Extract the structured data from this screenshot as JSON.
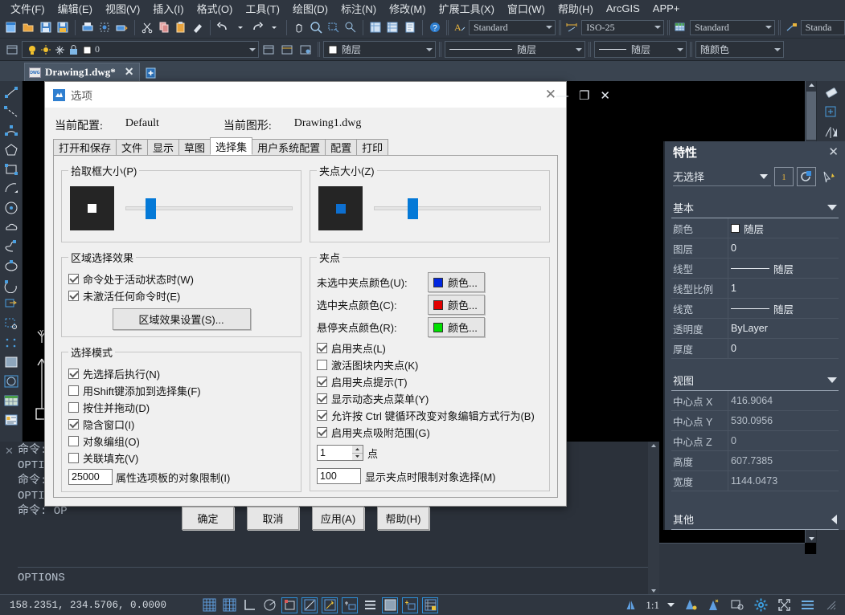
{
  "menubar": {
    "items": [
      "文件(F)",
      "编辑(E)",
      "视图(V)",
      "插入(I)",
      "格式(O)",
      "工具(T)",
      "绘图(D)",
      "标注(N)",
      "修改(M)",
      "扩展工具(X)",
      "窗口(W)",
      "帮助(H)",
      "ArcGIS",
      "APP+"
    ]
  },
  "toolbar1": {
    "style_combo": "Standard",
    "dim_combo": "ISO-25",
    "table_combo": "Standard",
    "multileader_combo": "Standa"
  },
  "toolbar2": {
    "layer_combo": "0",
    "color_combo": "随层",
    "linetype_combo": "随层",
    "lineweight_combo": "随层",
    "plotstyle_combo": "随颜色"
  },
  "drawing_tab": {
    "name": "Drawing1.dwg*",
    "close": "✕",
    "new_tab": "+"
  },
  "properties": {
    "title": "特性",
    "close": "✕",
    "selection": "无选择",
    "groups": [
      {
        "name": "基本",
        "rows": [
          {
            "key": "颜色",
            "value": "随层",
            "kind": "color"
          },
          {
            "key": "图层",
            "value": "0",
            "kind": "text"
          },
          {
            "key": "线型",
            "value": "随层",
            "kind": "line"
          },
          {
            "key": "线型比例",
            "value": "1",
            "kind": "text"
          },
          {
            "key": "线宽",
            "value": "随层",
            "kind": "line"
          },
          {
            "key": "透明度",
            "value": "ByLayer",
            "kind": "text"
          },
          {
            "key": "厚度",
            "value": "0",
            "kind": "text"
          }
        ]
      },
      {
        "name": "视图",
        "rows": [
          {
            "key": "中心点 X",
            "value": "416.9064",
            "kind": "dim"
          },
          {
            "key": "中心点 Y",
            "value": "530.0956",
            "kind": "dim"
          },
          {
            "key": "中心点 Z",
            "value": "0",
            "kind": "dim"
          },
          {
            "key": "高度",
            "value": "607.7385",
            "kind": "dim"
          },
          {
            "key": "宽度",
            "value": "1144.0473",
            "kind": "dim"
          }
        ]
      }
    ],
    "other_group": "其他"
  },
  "command": {
    "history": [
      "命令:",
      "OPTIONS",
      "命令:",
      "OPTIONS",
      "命令: OP"
    ],
    "current": "OPTIONS"
  },
  "statusbar": {
    "coords": "158.2351, 234.5706, 0.0000",
    "scale": "1:1"
  },
  "dialog": {
    "title": "选项",
    "close": "✕",
    "minimize": "—",
    "restore": "❐",
    "close_win": "✕",
    "current_profile_label": "当前配置:",
    "current_profile_value": "Default",
    "current_drawing_label": "当前图形:",
    "current_drawing_value": "Drawing1.dwg",
    "tabs": [
      "打开和保存",
      "文件",
      "显示",
      "草图",
      "选择集",
      "用户系统配置",
      "配置",
      "打印"
    ],
    "active_tab": "选择集",
    "pickbox": {
      "legend": "拾取框大小(P)",
      "slider_pct": 12
    },
    "gripsize": {
      "legend": "夹点大小(Z)",
      "slider_pct": 20
    },
    "area_effect": {
      "legend": "区域选择效果",
      "items": [
        {
          "label": "命令处于活动状态时(W)",
          "checked": true
        },
        {
          "label": "未激活任何命令时(E)",
          "checked": true
        }
      ],
      "button": "区域效果设置(S)..."
    },
    "selection_mode": {
      "legend": "选择模式",
      "items": [
        {
          "label": "先选择后执行(N)",
          "checked": true
        },
        {
          "label": "用Shift键添加到选择集(F)",
          "checked": false
        },
        {
          "label": "按住并拖动(D)",
          "checked": false
        },
        {
          "label": "隐含窗口(I)",
          "checked": true
        },
        {
          "label": "对象编组(O)",
          "checked": false
        },
        {
          "label": "关联填充(V)",
          "checked": false
        }
      ],
      "limit_value": "25000",
      "limit_label": "属性选项板的对象限制(I)"
    },
    "grips": {
      "legend": "夹点",
      "colors": [
        {
          "label": "未选中夹点颜色(U):",
          "button": "颜色...",
          "swatch": "#0026e0"
        },
        {
          "label": "选中夹点颜色(C):",
          "button": "颜色...",
          "swatch": "#e20000"
        },
        {
          "label": "悬停夹点颜色(R):",
          "button": "颜色...",
          "swatch": "#00e000"
        }
      ],
      "items": [
        {
          "label": "启用夹点(L)",
          "checked": true
        },
        {
          "label": "激活图块内夹点(K)",
          "checked": false
        },
        {
          "label": "启用夹点提示(T)",
          "checked": true
        },
        {
          "label": "显示动态夹点菜单(Y)",
          "checked": true
        },
        {
          "label": "允许按 Ctrl 键循环改变对象编辑方式行为(B)",
          "checked": true
        },
        {
          "label": "启用夹点吸附范围(G)",
          "checked": true
        }
      ],
      "spin_value": "1",
      "spin_label": "点",
      "limit_value": "100",
      "limit_label": "显示夹点时限制对象选择(M)"
    },
    "buttons": [
      "确定",
      "取消",
      "应用(A)",
      "帮助(H)"
    ]
  },
  "colors": {
    "accent": "#0479d7",
    "panel_bg": "#3c4654",
    "app_bg": "#2f3640",
    "canvas": "#000000",
    "dialog_bg": "#f0f0f0"
  }
}
